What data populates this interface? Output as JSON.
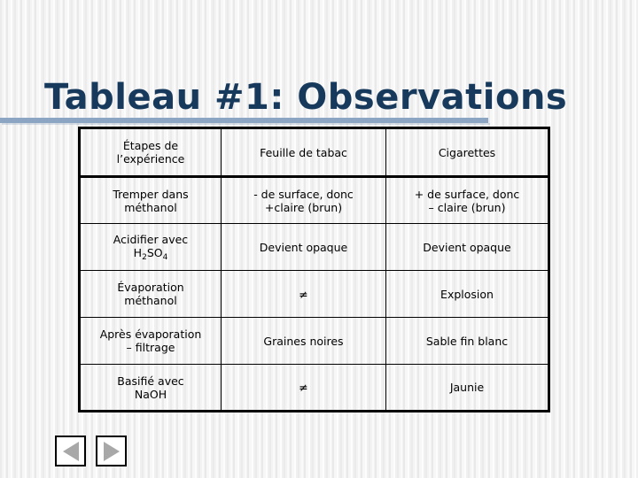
{
  "slide": {
    "title": "Tableau #1: Observations",
    "title_color": "#17395c",
    "rule_color": "#8ba5c2",
    "background_color": "#f2f2f2"
  },
  "table": {
    "headers": [
      "Étapes de\nl’expérience",
      "Feuille de tabac",
      "Cigarettes"
    ],
    "header_col1_line1": "Étapes de",
    "header_col1_line2": "l’expérience",
    "header_col2": "Feuille de tabac",
    "header_col3": "Cigarettes",
    "rows": [
      {
        "step_line1": "Tremper dans",
        "step_line2": "méthanol",
        "leaf_line1": "- de surface, donc",
        "leaf_line2": "+claire (brun)",
        "cig_line1": "+ de surface, donc",
        "cig_line2": "– claire (brun)"
      },
      {
        "step_line1": "Acidifier avec",
        "step_line2_pre": "H",
        "step_line2_sub1": "2",
        "step_line2_mid": "SO",
        "step_line2_sub2": "4",
        "leaf_line1": "Devient opaque",
        "leaf_line2": "",
        "cig_line1": "Devient opaque",
        "cig_line2": ""
      },
      {
        "step_line1": "Évaporation",
        "step_line2": "méthanol",
        "leaf_line1": "≠",
        "leaf_line2": "",
        "cig_line1": "Explosion",
        "cig_line2": ""
      },
      {
        "step_line1": "Après évaporation",
        "step_line2": "– filtrage",
        "leaf_line1": "Graines noires",
        "leaf_line2": "",
        "cig_line1": "Sable fin blanc",
        "cig_line2": ""
      },
      {
        "step_line1": "Basifié avec",
        "step_line2": "NaOH",
        "leaf_line1": "≠",
        "leaf_line2": "",
        "cig_line1": "Jaunie",
        "cig_line2": ""
      }
    ]
  },
  "navigation": {
    "previous_label": "",
    "next_label": "",
    "previous_icon": "triangle-left-icon",
    "next_icon": "triangle-right-icon",
    "triangle_color": "#a8a8a8"
  }
}
